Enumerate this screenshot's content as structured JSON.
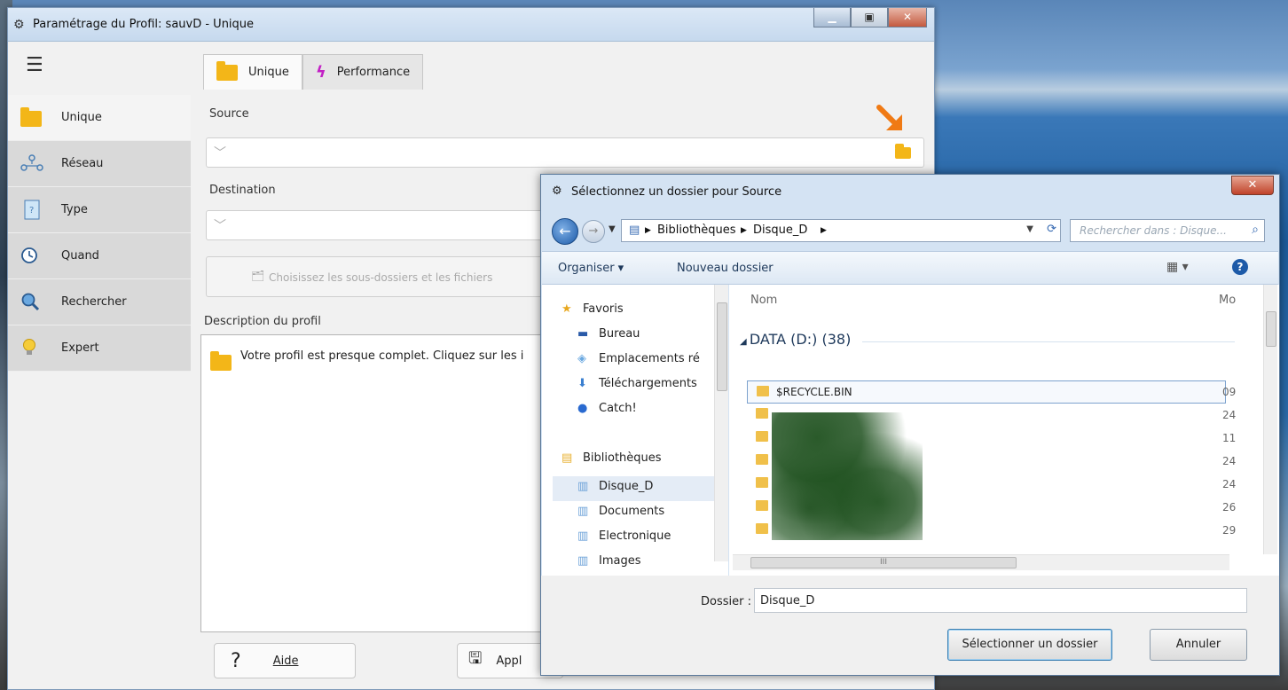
{
  "main_window": {
    "title": "Paramétrage du Profil: sauvD - Unique",
    "controls": {
      "minimize": "▁",
      "maximize": "▣",
      "close": "✕"
    }
  },
  "sidebar": {
    "menu_icon": "☰",
    "items": [
      {
        "label": "Unique",
        "icon": "folder-icon",
        "active": true
      },
      {
        "label": "Réseau",
        "icon": "network-icon"
      },
      {
        "label": "Type",
        "icon": "file-type-icon"
      },
      {
        "label": "Quand",
        "icon": "clock-icon"
      },
      {
        "label": "Rechercher",
        "icon": "search-icon"
      },
      {
        "label": "Expert",
        "icon": "lightbulb-icon"
      }
    ]
  },
  "tabs": [
    {
      "label": "Unique",
      "icon": "folder-icon",
      "active": true
    },
    {
      "label": "Performance",
      "icon": "lightning-icon"
    }
  ],
  "form": {
    "source_label": "Source",
    "destination_label": "Destination",
    "subfolders_button": "Choisissez les sous-dossiers et les fichiers",
    "description_label": "Description du profil",
    "description_text": "Votre profil est presque complet. Cliquez sur les i"
  },
  "bottom_buttons": {
    "help_label": "Aide",
    "help_icon": "?",
    "apply_label": "Appl"
  },
  "dialog": {
    "title": "Sélectionnez un dossier pour Source",
    "close": "✕",
    "breadcrumb": [
      "Bibliothèques",
      "Disque_D"
    ],
    "search_placeholder": "Rechercher dans : Disque...",
    "commands": {
      "organize": "Organiser ▾",
      "new_folder": "Nouveau dossier"
    },
    "nav_pane": {
      "favorites": "Favoris",
      "favorites_items": [
        "Bureau",
        "Emplacements ré",
        "Téléchargements",
        "Catch!"
      ],
      "libraries": "Bibliothèques",
      "libraries_items": [
        "Disque_D",
        "Documents",
        "Electronique",
        "Images"
      ],
      "selected": "Disque_D"
    },
    "file_pane": {
      "column_name": "Nom",
      "column_modified": "Mo",
      "group_header": "DATA (D:) (38)",
      "rows": [
        {
          "name": "$RECYCLE.BIN",
          "date": "09"
        },
        {
          "name": "",
          "date": "24"
        },
        {
          "name": "",
          "date": "11"
        },
        {
          "name": "",
          "date": "24"
        },
        {
          "name": "",
          "date": "24"
        },
        {
          "name": "",
          "date": "26"
        },
        {
          "name": "",
          "date": "29"
        }
      ]
    },
    "folder_label": "Dossier :",
    "folder_value": "Disque_D",
    "select_button": "Sélectionner un dossier",
    "cancel_button": "Annuler"
  },
  "colors": {
    "accent": "#f3b618",
    "arrow": "#f07a14",
    "bolt": "#c21fc5"
  }
}
